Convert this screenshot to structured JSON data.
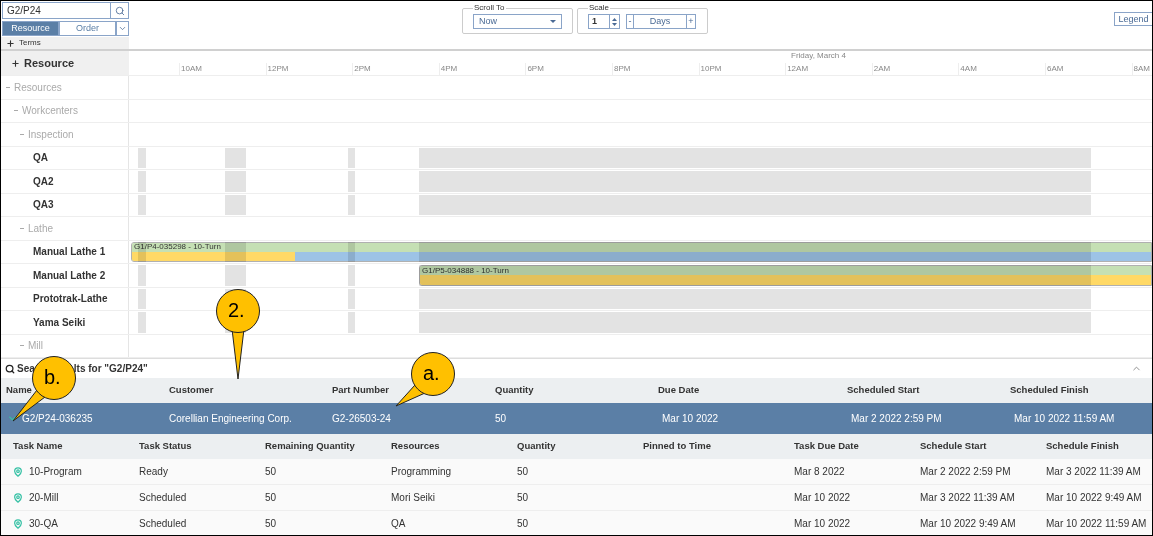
{
  "search": {
    "value": "G2/P24"
  },
  "view_tabs": [
    {
      "label": "Resource",
      "selected": true
    },
    {
      "label": "Order",
      "selected": false
    }
  ],
  "scroll_to": {
    "legend": "Scroll To",
    "value": "Now"
  },
  "scale": {
    "legend": "Scale",
    "amount": "1",
    "minus": "-",
    "unit": "Days",
    "plus": "+"
  },
  "legend_button": "Legend",
  "terms": {
    "label": "Terms",
    "expanded": false
  },
  "resource_header": {
    "label": "Resource",
    "expanded": false
  },
  "timeline": {
    "date": "Friday, March 4",
    "ticks": [
      "10AM",
      "12PM",
      "2PM",
      "4PM",
      "6PM",
      "8PM",
      "10PM",
      "12AM",
      "2AM",
      "4AM",
      "6AM",
      "8AM"
    ]
  },
  "tree": [
    {
      "label": "Resources",
      "kind": "group",
      "expanded": true,
      "children": [
        {
          "label": "Workcenters",
          "kind": "group",
          "expanded": true,
          "children": [
            {
              "label": "Inspection",
              "kind": "group",
              "expanded": true,
              "children": [
                {
                  "label": "QA",
                  "kind": "resource"
                },
                {
                  "label": "QA2",
                  "kind": "resource"
                },
                {
                  "label": "QA3",
                  "kind": "resource"
                }
              ]
            },
            {
              "label": "Lathe",
              "kind": "group",
              "expanded": true,
              "children": [
                {
                  "label": "Manual Lathe 1",
                  "kind": "resource",
                  "bars": [
                    {
                      "label": "G1/P4-035298 - 10-Turn",
                      "level": 0.16
                    }
                  ]
                },
                {
                  "label": "Manual Lathe 2",
                  "kind": "resource",
                  "bars": [
                    {
                      "label": "G1/P5-034888 - 10-Turn",
                      "level": 1
                    }
                  ]
                },
                {
                  "label": "Prototrak-Lathe",
                  "kind": "resource"
                },
                {
                  "label": "Yama Seiki",
                  "kind": "resource"
                }
              ]
            },
            {
              "label": "Mill",
              "kind": "group",
              "expanded": true
            }
          ]
        }
      ]
    }
  ],
  "results": {
    "title_parts": [
      "Sea",
      "lts for \"G2/P24\""
    ],
    "columns": [
      "Name",
      "Customer",
      "Part Number",
      "Quantity",
      "Due Date",
      "Scheduled Start",
      "Scheduled Finish"
    ],
    "orders": [
      {
        "selected": true,
        "expanded": true,
        "cells": [
          "G2/P24-036235",
          "Corellian Engineering Corp.",
          "G2-26503-24",
          "50",
          "Mar 10 2022",
          "Mar 2 2022 2:59 PM",
          "Mar 10 2022 11:59 AM"
        ],
        "task_columns": [
          "Task Name",
          "Task Status",
          "Remaining Quantity",
          "Resources",
          "Quantity",
          "Pinned to Time",
          "Task Due Date",
          "Schedule Start",
          "Schedule Finish"
        ],
        "tasks": [
          {
            "name": "10-Program",
            "status": "Ready",
            "remaining": "50",
            "resources": "Programming",
            "quantity": "50",
            "due": "Mar 8 2022",
            "start": "Mar 2 2022 2:59 PM",
            "finish": "Mar 3 2022 11:39 AM"
          },
          {
            "name": "20-Mill",
            "status": "Scheduled",
            "remaining": "50",
            "resources": "Mori Seiki",
            "quantity": "50",
            "due": "Mar 10 2022",
            "start": "Mar 3 2022 11:39 AM",
            "finish": "Mar 10 2022 9:49 AM"
          },
          {
            "name": "30-QA",
            "status": "Scheduled",
            "remaining": "50",
            "resources": "QA",
            "quantity": "50",
            "due": "Mar 10 2022",
            "start": "Mar 10 2022 9:49 AM",
            "finish": "Mar 10 2022 11:59 AM"
          }
        ]
      }
    ]
  },
  "annotations": [
    {
      "label": "2."
    },
    {
      "label": "a."
    },
    {
      "label": "b."
    }
  ]
}
